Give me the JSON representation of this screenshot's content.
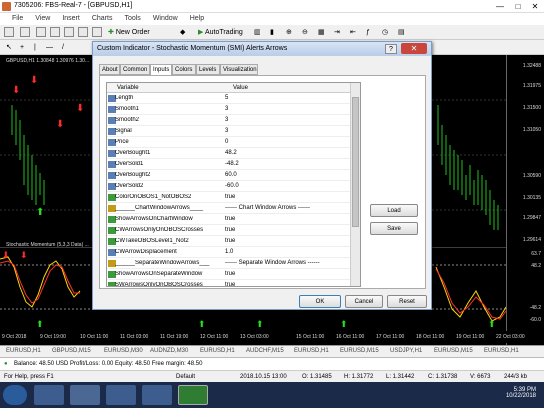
{
  "window": {
    "title": "7305206: FBS-Real-7 - [GBPUSD,H1]"
  },
  "menu": [
    "File",
    "View",
    "Insert",
    "Charts",
    "Tools",
    "Window",
    "Help"
  ],
  "toolbar": {
    "new_order": "New Order",
    "autotrading": "AutoTrading"
  },
  "chart": {
    "symbol_info": "GBPUSD,H1  1.30848 1.30976 1.30...",
    "prices": [
      "1.32488",
      "1.31975",
      "1.31500",
      "1.31050",
      "1.30590",
      "1.30135",
      "1.29847",
      "1.29614"
    ],
    "indicator_label": "Stochastic Momentum (5,3,3 Data) ...",
    "indicator_levels": [
      "63.7",
      "48.2",
      "-48.2",
      "-60.0"
    ],
    "dates": [
      "9 Oct 2018",
      "9 Oct 19:00",
      "10 Oct 11:00",
      "11 Oct 03:00",
      "11 Oct 19:00",
      "12 Oct 11:00",
      "13 Oct 03:00",
      "15 Oct 11:00",
      "16 Oct 11:00",
      "17 Oct 11:00",
      "18 Oct 11:00",
      "19 Oct 11:00",
      "22 Oct 03:00"
    ]
  },
  "dialog": {
    "title": "Custom Indicator - Stochastic Momentum (SMI) Alerts Arrows",
    "tabs": [
      "About",
      "Common",
      "Inputs",
      "Colors",
      "Levels",
      "Visualization"
    ],
    "active_tab": "Inputs",
    "columns": {
      "variable": "Variable",
      "value": "Value"
    },
    "rows": [
      {
        "icon": "123",
        "name": "Length",
        "value": "5"
      },
      {
        "icon": "123",
        "name": "Smooth1",
        "value": "3"
      },
      {
        "icon": "123",
        "name": "Smooth2",
        "value": "3"
      },
      {
        "icon": "123",
        "name": "Signal",
        "value": "3"
      },
      {
        "icon": "123",
        "name": "Price",
        "value": "0"
      },
      {
        "icon": "v2",
        "name": "OverBought1",
        "value": "48.2"
      },
      {
        "icon": "v2",
        "name": "OverSold1",
        "value": "-48.2"
      },
      {
        "icon": "v2",
        "name": "OverBought2",
        "value": "60.0"
      },
      {
        "icon": "v2",
        "name": "OverSold2",
        "value": "-60.0"
      },
      {
        "icon": "bool",
        "name": "ColorOnOBOS1_NotOBOS2",
        "value": "true"
      },
      {
        "icon": "ab",
        "name": "______ChartWindowArrows____",
        "value": "------ Chart Window Arrows ------"
      },
      {
        "icon": "bool",
        "name": "ShowArrowsOnChartWindow",
        "value": "true"
      },
      {
        "icon": "bool",
        "name": "CWArrowsOnlyOnOBOSCrosses",
        "value": "true"
      },
      {
        "icon": "bool",
        "name": "CWTakeOBOSLevel1_Not2",
        "value": "true"
      },
      {
        "icon": "v2",
        "name": "CWArrowDisplacement",
        "value": "1.0"
      },
      {
        "icon": "ab",
        "name": "______SeparateWindowArrows___",
        "value": "------ Separate Window Arrows ------"
      },
      {
        "icon": "bool",
        "name": "ShowArrowsOnSeparateWindow",
        "value": "true"
      },
      {
        "icon": "bool",
        "name": "SWArrowsOnlyOnOBOSCrosses",
        "value": "true"
      },
      {
        "icon": "bool",
        "name": "SWTakeOBOSLevel1_Not2",
        "value": "true"
      }
    ],
    "buttons": {
      "load": "Load",
      "save": "Save",
      "ok": "OK",
      "cancel": "Cancel",
      "reset": "Reset"
    }
  },
  "symbol_tabs": [
    "EURUSD,H1",
    "GBPUSD,M15",
    "EURUSD,M30",
    "AUDNZD,M30",
    "EURUSD,H1",
    "AUDCHF,M15",
    "EURUSD,H1",
    "EURUSD,M15",
    "USDJPY,H1",
    "EURUSD,M15",
    "EURUSD,H1"
  ],
  "account": {
    "text": "Balance: 48.50 USD  Profit/Loss: 0.00  Equity: 48.50  Free margin: 48.50"
  },
  "status": {
    "help": "For Help, press F1",
    "profile": "Default",
    "datetime": "2018.10.15 13:00",
    "open": "O: 1.31485",
    "high": "H: 1.31772",
    "low": "L: 1.31442",
    "close": "C: 1.31738",
    "volume": "V: 6673",
    "traffic": "244/3 kb"
  },
  "taskbar": {
    "time": "5:39 PM",
    "date": "10/22/2018"
  },
  "colors": {
    "dialog_border": "#7a9cc6",
    "close": "#c9463d",
    "chart_bg": "#000000"
  }
}
